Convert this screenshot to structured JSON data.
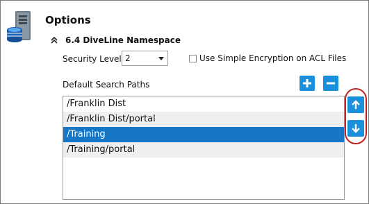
{
  "panel": {
    "title": "Options",
    "section_title": "6.4 DiveLine Namespace"
  },
  "security": {
    "label": "Security Level",
    "value": "2"
  },
  "encryption": {
    "label": "Use Simple Encryption on ACL Files",
    "checked": false
  },
  "search_paths": {
    "label": "Default Search Paths",
    "items": [
      {
        "label": "/Franklin Dist",
        "selected": false
      },
      {
        "label": "/Franklin Dist/portal",
        "selected": false
      },
      {
        "label": "/Training",
        "selected": true
      },
      {
        "label": "/Training/portal",
        "selected": false
      }
    ]
  },
  "icons": {
    "options": "database-server-icon",
    "collapse": "double-chevron-up-icon",
    "dropdown": "caret-down-icon",
    "add": "plus-icon",
    "remove": "minus-icon",
    "move_up": "arrow-up-icon",
    "move_down": "arrow-down-icon"
  },
  "colors": {
    "accent": "#1a8fdc",
    "selection": "#1677c7",
    "highlight": "#c02020"
  }
}
